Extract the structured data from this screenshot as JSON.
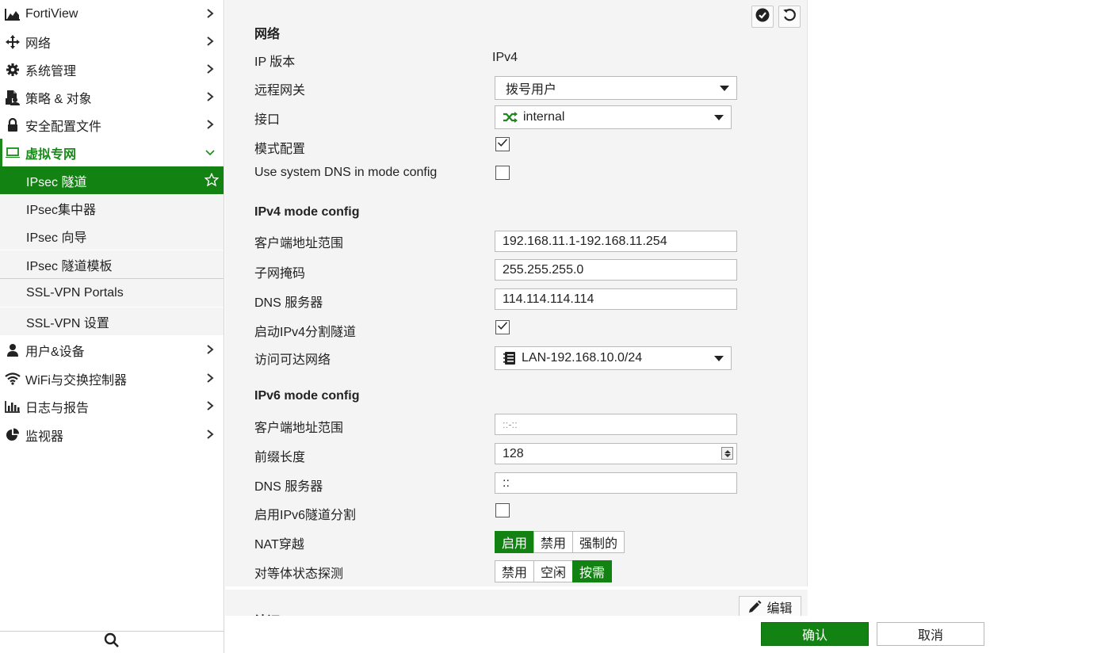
{
  "colors": {
    "accent": "#128212",
    "accent_text": "#1a8a1a",
    "panel_bg": "#f4f4f4"
  },
  "sidebar": {
    "items": [
      {
        "label": "FortiView",
        "icon": "chart-area-icon"
      },
      {
        "label": "网络",
        "icon": "move-arrows-icon"
      },
      {
        "label": "系统管理",
        "icon": "gear-icon"
      },
      {
        "label": "策略 & 对象",
        "icon": "document-user-icon"
      },
      {
        "label": "安全配置文件",
        "icon": "lock-icon"
      },
      {
        "label": "虚拟专网",
        "icon": "laptop-icon",
        "expanded": true
      },
      {
        "label": "用户&设备",
        "icon": "user-icon"
      },
      {
        "label": "WiFi与交换控制器",
        "icon": "wifi-icon"
      },
      {
        "label": "日志与报告",
        "icon": "bar-chart-icon"
      },
      {
        "label": "监视器",
        "icon": "pie-chart-icon"
      }
    ],
    "vpn_sub": [
      {
        "label": "IPsec 隧道",
        "active": true
      },
      {
        "label": "IPsec集中器"
      },
      {
        "label": "IPsec 向导"
      },
      {
        "label": "IPsec 隧道模板"
      },
      {
        "label": "SSL-VPN Portals"
      },
      {
        "label": "SSL-VPN 设置"
      }
    ]
  },
  "form": {
    "network_title": "网络",
    "ip_version_label": "IP 版本",
    "ip_version_value": "IPv4",
    "remote_gw_label": "远程网关",
    "remote_gw_value": "拨号用户",
    "interface_label": "接口",
    "interface_value": "internal",
    "mode_cfg_label": "模式配置",
    "mode_cfg_checked": true,
    "sys_dns_label": "Use system DNS in mode config",
    "sys_dns_checked": false,
    "ipv4_title": "IPv4 mode config",
    "v4_range_label": "客户端地址范围",
    "v4_range_value": "192.168.11.1-192.168.11.254",
    "v4_mask_label": "子网掩码",
    "v4_mask_value": "255.255.255.0",
    "v4_dns_label": "DNS 服务器",
    "v4_dns_value": "114.114.114.114",
    "v4_split_label": "启动IPv4分割隧道",
    "v4_split_checked": true,
    "v4_access_label": "访问可达网络",
    "v4_access_value": "LAN-192.168.10.0/24",
    "ipv6_title": "IPv6 mode config",
    "v6_range_label": "客户端地址范围",
    "v6_range_placeholder": "::-::",
    "v6_prefix_label": "前缀长度",
    "v6_prefix_value": "128",
    "v6_dns_label": "DNS 服务器",
    "v6_dns_value": "::",
    "v6_split_label": "启用IPv6隧道分割",
    "v6_split_checked": false,
    "nat_label": "NAT穿越",
    "nat_options": [
      "启用",
      "禁用",
      "强制的"
    ],
    "nat_selected": "启用",
    "dpd_label": "对等体状态探测",
    "dpd_options": [
      "禁用",
      "空闲",
      "按需"
    ],
    "dpd_selected": "按需",
    "edit_label": "编辑",
    "next_section_title": "认证"
  },
  "footer": {
    "ok": "确认",
    "cancel": "取消"
  }
}
